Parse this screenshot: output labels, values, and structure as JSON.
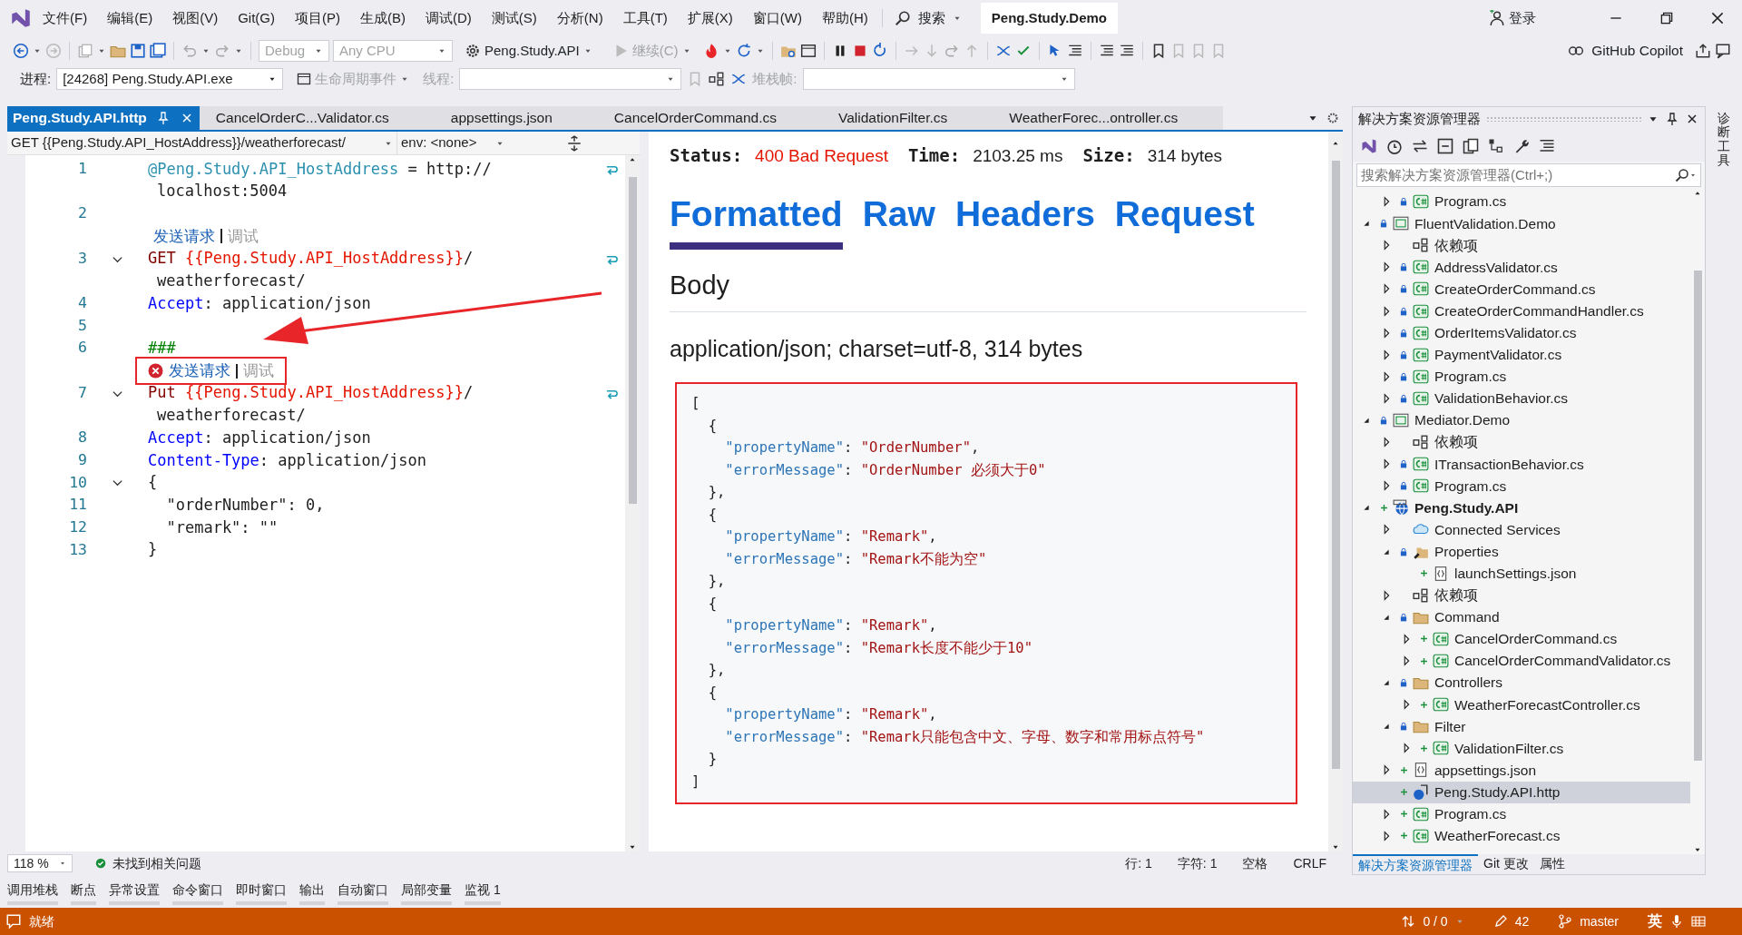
{
  "title_bar": {
    "menu": [
      "文件(F)",
      "编辑(E)",
      "视图(V)",
      "Git(G)",
      "项目(P)",
      "生成(B)",
      "调试(D)",
      "测试(S)",
      "分析(N)",
      "工具(T)",
      "扩展(X)",
      "窗口(W)",
      "帮助(H)"
    ],
    "search": "搜索",
    "solution": "Peng.Study.Demo",
    "sign_in": "登录"
  },
  "toolbar": {
    "configuration": {
      "text": "Debug",
      "disabled": true
    },
    "platform": {
      "text": "Any CPU",
      "disabled": true
    },
    "startup": {
      "text": "Peng.Study.API",
      "disabled": false
    },
    "continue": {
      "text": "继续(C)",
      "disabled": true
    },
    "copilot": "GitHub Copilot"
  },
  "debug_location": {
    "process_label": "进程:",
    "process": "[24268] Peng.Study.API.exe",
    "lifecycle": "生命周期事件",
    "thread_label": "线程:",
    "stack_label": "堆栈帧:"
  },
  "doc_tabs": [
    {
      "label": "Peng.Study.API.http",
      "selected": true
    },
    {
      "label": "CancelOrderC...Validator.cs",
      "selected": false
    },
    {
      "label": "appsettings.json",
      "selected": false
    },
    {
      "label": "CancelOrderCommand.cs",
      "selected": false
    },
    {
      "label": "ValidationFilter.cs",
      "selected": false
    },
    {
      "label": "WeatherForec...ontroller.cs",
      "selected": false
    }
  ],
  "editor": {
    "request_selector": "GET {{Peng.Study.API_HostAddress}}/weatherforecast/",
    "environment": "env: <none>",
    "lines": [
      {
        "kind": "code",
        "number": "1",
        "fold": false,
        "tokens": [
          {
            "kind": "var",
            "t": "@Peng.Study.API_HostAddress"
          },
          {
            "kind": "plain",
            "t": " = http://"
          }
        ]
      },
      {
        "kind": "wrap",
        "tokens": [
          {
            "kind": "plain",
            "t": "localhost:5004"
          }
        ]
      },
      {
        "kind": "code",
        "number": "2",
        "fold": false
      },
      {
        "kind": "lens",
        "send": "发送请求",
        "debug": "调试",
        "error": false,
        "annotated": false
      },
      {
        "kind": "code",
        "number": "3",
        "fold": true,
        "tokens": [
          {
            "kind": "method",
            "t": "GET "
          },
          {
            "kind": "ref",
            "t": "{{Peng.Study.API_HostAddress}}"
          },
          {
            "kind": "plain",
            "t": "/"
          }
        ]
      },
      {
        "kind": "wrap",
        "tokens": [
          {
            "kind": "plain",
            "t": "weatherforecast/"
          }
        ]
      },
      {
        "kind": "code",
        "number": "4",
        "fold": false,
        "tokens": [
          {
            "kind": "header",
            "t": "Accept"
          },
          {
            "kind": "plain",
            "t": ": application/json"
          }
        ]
      },
      {
        "kind": "code",
        "number": "5",
        "fold": false
      },
      {
        "kind": "code",
        "number": "6",
        "fold": false,
        "tokens": [
          {
            "kind": "comment",
            "t": "###"
          }
        ]
      },
      {
        "kind": "lens",
        "send": "发送请求",
        "debug": "调试",
        "error": true,
        "annotated": true
      },
      {
        "kind": "code",
        "number": "7",
        "fold": true,
        "tokens": [
          {
            "kind": "method",
            "t": "Put "
          },
          {
            "kind": "ref",
            "t": "{{Peng.Study.API_HostAddress}}"
          },
          {
            "kind": "plain",
            "t": "/"
          }
        ]
      },
      {
        "kind": "wrap",
        "tokens": [
          {
            "kind": "plain",
            "t": "weatherforecast/"
          }
        ]
      },
      {
        "kind": "code",
        "number": "8",
        "fold": false,
        "tokens": [
          {
            "kind": "header",
            "t": "Accept"
          },
          {
            "kind": "plain",
            "t": ": application/json"
          }
        ]
      },
      {
        "kind": "code",
        "number": "9",
        "fold": false,
        "tokens": [
          {
            "kind": "header",
            "t": "Content-Type"
          },
          {
            "kind": "plain",
            "t": ": application/json"
          }
        ]
      },
      {
        "kind": "code",
        "number": "10",
        "fold": true,
        "tokens": [
          {
            "kind": "plain",
            "t": "{"
          }
        ]
      },
      {
        "kind": "code",
        "number": "11",
        "fold": false,
        "tokens": [
          {
            "kind": "plain",
            "t": "  \"orderNumber\": 0,"
          }
        ]
      },
      {
        "kind": "code",
        "number": "12",
        "fold": false,
        "tokens": [
          {
            "kind": "plain",
            "t": "  \"remark\": \"\""
          }
        ]
      },
      {
        "kind": "code",
        "number": "13",
        "fold": false,
        "tokens": [
          {
            "kind": "plain",
            "t": "}"
          }
        ]
      }
    ],
    "zoom": "118 %",
    "issues": "未找到相关问题",
    "line_pos": "行: 1",
    "char_pos": "字符: 1",
    "indent": "空格",
    "line_ending": "CRLF"
  },
  "response": {
    "status_label": "Status:",
    "status": "400 Bad Request",
    "time_label": "Time:",
    "time": "2103.25 ms",
    "size_label": "Size:",
    "size": "314 bytes",
    "tabs": [
      {
        "label": "Formatted",
        "selected": true
      },
      {
        "label": "Raw",
        "selected": false
      },
      {
        "label": "Headers",
        "selected": false
      },
      {
        "label": "Request",
        "selected": false
      }
    ],
    "section": "Body",
    "content_type": "application/json; charset=utf-8, 314 bytes",
    "body": [
      [
        {
          "kind": "p",
          "t": "["
        }
      ],
      [
        {
          "kind": "p",
          "t": "  {"
        }
      ],
      [
        {
          "kind": "key",
          "t": "    \"propertyName\""
        },
        {
          "kind": "p",
          "t": ": "
        },
        {
          "kind": "str",
          "t": "\"OrderNumber\""
        },
        {
          "kind": "p",
          "t": ","
        }
      ],
      [
        {
          "kind": "key",
          "t": "    \"errorMessage\""
        },
        {
          "kind": "p",
          "t": ": "
        },
        {
          "kind": "str",
          "t": "\"OrderNumber 必须大于0\""
        }
      ],
      [
        {
          "kind": "p",
          "t": "  },"
        }
      ],
      [
        {
          "kind": "p",
          "t": "  {"
        }
      ],
      [
        {
          "kind": "key",
          "t": "    \"propertyName\""
        },
        {
          "kind": "p",
          "t": ": "
        },
        {
          "kind": "str",
          "t": "\"Remark\""
        },
        {
          "kind": "p",
          "t": ","
        }
      ],
      [
        {
          "kind": "key",
          "t": "    \"errorMessage\""
        },
        {
          "kind": "p",
          "t": ": "
        },
        {
          "kind": "str",
          "t": "\"Remark不能为空\""
        }
      ],
      [
        {
          "kind": "p",
          "t": "  },"
        }
      ],
      [
        {
          "kind": "p",
          "t": "  {"
        }
      ],
      [
        {
          "kind": "key",
          "t": "    \"propertyName\""
        },
        {
          "kind": "p",
          "t": ": "
        },
        {
          "kind": "str",
          "t": "\"Remark\""
        },
        {
          "kind": "p",
          "t": ","
        }
      ],
      [
        {
          "kind": "key",
          "t": "    \"errorMessage\""
        },
        {
          "kind": "p",
          "t": ": "
        },
        {
          "kind": "str",
          "t": "\"Remark长度不能少于10\""
        }
      ],
      [
        {
          "kind": "p",
          "t": "  },"
        }
      ],
      [
        {
          "kind": "p",
          "t": "  {"
        }
      ],
      [
        {
          "kind": "key",
          "t": "    \"propertyName\""
        },
        {
          "kind": "p",
          "t": ": "
        },
        {
          "kind": "str",
          "t": "\"Remark\""
        },
        {
          "kind": "p",
          "t": ","
        }
      ],
      [
        {
          "kind": "key",
          "t": "    \"errorMessage\""
        },
        {
          "kind": "p",
          "t": ": "
        },
        {
          "kind": "str",
          "t": "\"Remark只能包含中文、字母、数字和常用标点符号\""
        }
      ],
      [
        {
          "kind": "p",
          "t": "  }"
        }
      ],
      [
        {
          "kind": "p",
          "t": "]"
        }
      ]
    ]
  },
  "solution_explorer": {
    "title": "解决方案资源管理器",
    "search_placeholder": "搜索解决方案资源管理器(Ctrl+;)",
    "tree": [
      {
        "children": [
          {
            "label": "Program.cs",
            "kind": "cs",
            "locked": true,
            "added": false,
            "expandable": true,
            "expanded": false,
            "selected": false
          }
        ]
      },
      {
        "label": "FluentValidation.Demo",
        "kind": "project",
        "locked": true,
        "added": false,
        "expandable": true,
        "expanded": true,
        "selected": false,
        "children": [
          {
            "label": "依赖项",
            "kind": "deps",
            "locked": false,
            "added": false,
            "expandable": true,
            "expanded": false,
            "selected": false
          },
          {
            "label": "AddressValidator.cs",
            "kind": "cs",
            "locked": true,
            "added": false,
            "expandable": true,
            "expanded": false,
            "selected": false
          },
          {
            "label": "CreateOrderCommand.cs",
            "kind": "cs",
            "locked": true,
            "added": false,
            "expandable": true,
            "expanded": false,
            "selected": false
          },
          {
            "label": "CreateOrderCommandHandler.cs",
            "kind": "cs",
            "locked": true,
            "added": false,
            "expandable": true,
            "expanded": false,
            "selected": false
          },
          {
            "label": "OrderItemsValidator.cs",
            "kind": "cs",
            "locked": true,
            "added": false,
            "expandable": true,
            "expanded": false,
            "selected": false
          },
          {
            "label": "PaymentValidator.cs",
            "kind": "cs",
            "locked": true,
            "added": false,
            "expandable": true,
            "expanded": false,
            "selected": false
          },
          {
            "label": "Program.cs",
            "kind": "cs",
            "locked": true,
            "added": false,
            "expandable": true,
            "expanded": false,
            "selected": false
          },
          {
            "label": "ValidationBehavior.cs",
            "kind": "cs",
            "locked": true,
            "added": false,
            "expandable": true,
            "expanded": false,
            "selected": false
          }
        ]
      },
      {
        "label": "Mediator.Demo",
        "kind": "project",
        "locked": true,
        "added": false,
        "expandable": true,
        "expanded": true,
        "selected": false,
        "children": [
          {
            "label": "依赖项",
            "kind": "deps",
            "locked": false,
            "added": false,
            "expandable": true,
            "expanded": false,
            "selected": false
          },
          {
            "label": "ITransactionBehavior.cs",
            "kind": "cs",
            "locked": true,
            "added": false,
            "expandable": true,
            "expanded": false,
            "selected": false
          },
          {
            "label": "Program.cs",
            "kind": "cs",
            "locked": true,
            "added": false,
            "expandable": true,
            "expanded": false,
            "selected": false
          }
        ]
      },
      {
        "label": "Peng.Study.API",
        "kind": "web",
        "locked": false,
        "added": true,
        "expandable": true,
        "expanded": true,
        "selected": false,
        "bold": true,
        "children": [
          {
            "label": "Connected Services",
            "kind": "cloud",
            "locked": false,
            "added": false,
            "expandable": true,
            "expanded": false,
            "selected": false
          },
          {
            "label": "Properties",
            "kind": "props",
            "locked": true,
            "added": false,
            "expandable": true,
            "expanded": true,
            "selected": false,
            "children": [
              {
                "label": "launchSettings.json",
                "kind": "json",
                "locked": false,
                "added": true,
                "expandable": false,
                "selected": false
              }
            ]
          },
          {
            "label": "依赖项",
            "kind": "deps",
            "locked": false,
            "added": false,
            "expandable": true,
            "expanded": false,
            "selected": false
          },
          {
            "label": "Command",
            "kind": "folder",
            "locked": true,
            "added": false,
            "expandable": true,
            "expanded": true,
            "selected": false,
            "children": [
              {
                "label": "CancelOrderCommand.cs",
                "kind": "cs",
                "locked": false,
                "added": true,
                "expandable": true,
                "expanded": false,
                "selected": false
              },
              {
                "label": "CancelOrderCommandValidator.cs",
                "kind": "cs",
                "locked": false,
                "added": true,
                "expandable": true,
                "expanded": false,
                "selected": false
              }
            ]
          },
          {
            "label": "Controllers",
            "kind": "folder",
            "locked": true,
            "added": false,
            "expandable": true,
            "expanded": true,
            "selected": false,
            "children": [
              {
                "label": "WeatherForecastController.cs",
                "kind": "cs",
                "locked": false,
                "added": true,
                "expandable": true,
                "expanded": false,
                "selected": false
              }
            ]
          },
          {
            "label": "Filter",
            "kind": "folder",
            "locked": true,
            "added": false,
            "expandable": true,
            "expanded": true,
            "selected": false,
            "children": [
              {
                "label": "ValidationFilter.cs",
                "kind": "cs",
                "locked": false,
                "added": true,
                "expandable": true,
                "expanded": false,
                "selected": false
              }
            ]
          },
          {
            "label": "appsettings.json",
            "kind": "json",
            "locked": false,
            "added": true,
            "expandable": true,
            "expanded": false,
            "selected": false
          },
          {
            "label": "Peng.Study.API.http",
            "kind": "http",
            "locked": false,
            "added": true,
            "expandable": false,
            "selected": true
          },
          {
            "label": "Program.cs",
            "kind": "cs",
            "locked": false,
            "added": true,
            "expandable": true,
            "expanded": false,
            "selected": false
          },
          {
            "label": "WeatherForecast.cs",
            "kind": "cs",
            "locked": false,
            "added": true,
            "expandable": true,
            "expanded": false,
            "selected": false
          }
        ]
      }
    ],
    "bottom_tabs": [
      {
        "label": "解决方案资源管理器",
        "selected": true
      },
      {
        "label": "Git 更改",
        "selected": false
      },
      {
        "label": "属性",
        "selected": false
      }
    ]
  },
  "side_strip": "诊断工具",
  "tool_windows": [
    "调用堆栈",
    "断点",
    "异常设置",
    "命令窗口",
    "即时窗口",
    "输出",
    "自动窗口",
    "局部变量",
    "监视 1"
  ],
  "status_bar": {
    "state": "就绪",
    "changes": "0 / 0",
    "edits": "42",
    "branch": "master",
    "ime": "英"
  }
}
